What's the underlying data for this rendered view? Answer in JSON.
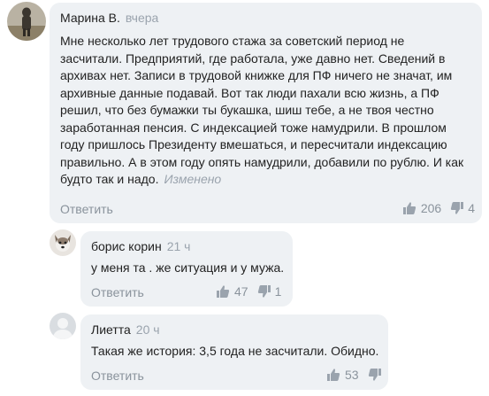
{
  "comments": [
    {
      "author": "Марина В.",
      "time": "вчера",
      "lines": [
        "Мне несколько лет трудового стажа за советский период не",
        "засчитали. Предприятий, где работала, уже давно нет. Сведений в",
        "архивах нет. Записи в трудовой книжке для ПФ ничего не значат, им",
        "архивные данные подавай. Вот так люди пахали всю жизнь, а ПФ",
        "решил, что без бумажки ты букашка, шиш тебе, а не твоя честно",
        "заработанная пенсия. С индексацией тоже намудрили. В прошлом",
        "году пришлось Президенту вмешаться, и пересчитали индексацию",
        "правильно.  А в этом году опять намудрили, добавили по рублю.  И как",
        "будто так и надо."
      ],
      "edited": "Изменено",
      "reply_label": "Ответить",
      "likes": "206",
      "dislikes": "4"
    },
    {
      "author": "борис корин",
      "time": "21 ч",
      "lines": [
        "у меня та . же ситуация и у мужа."
      ],
      "reply_label": "Ответить",
      "likes": "47",
      "dislikes": "1"
    },
    {
      "author": "Лиетта",
      "time": "20 ч",
      "lines": [
        "Такая же история: 3,5 года не засчитали.  Обидно."
      ],
      "reply_label": "Ответить",
      "likes": "53",
      "dislikes": ""
    }
  ]
}
